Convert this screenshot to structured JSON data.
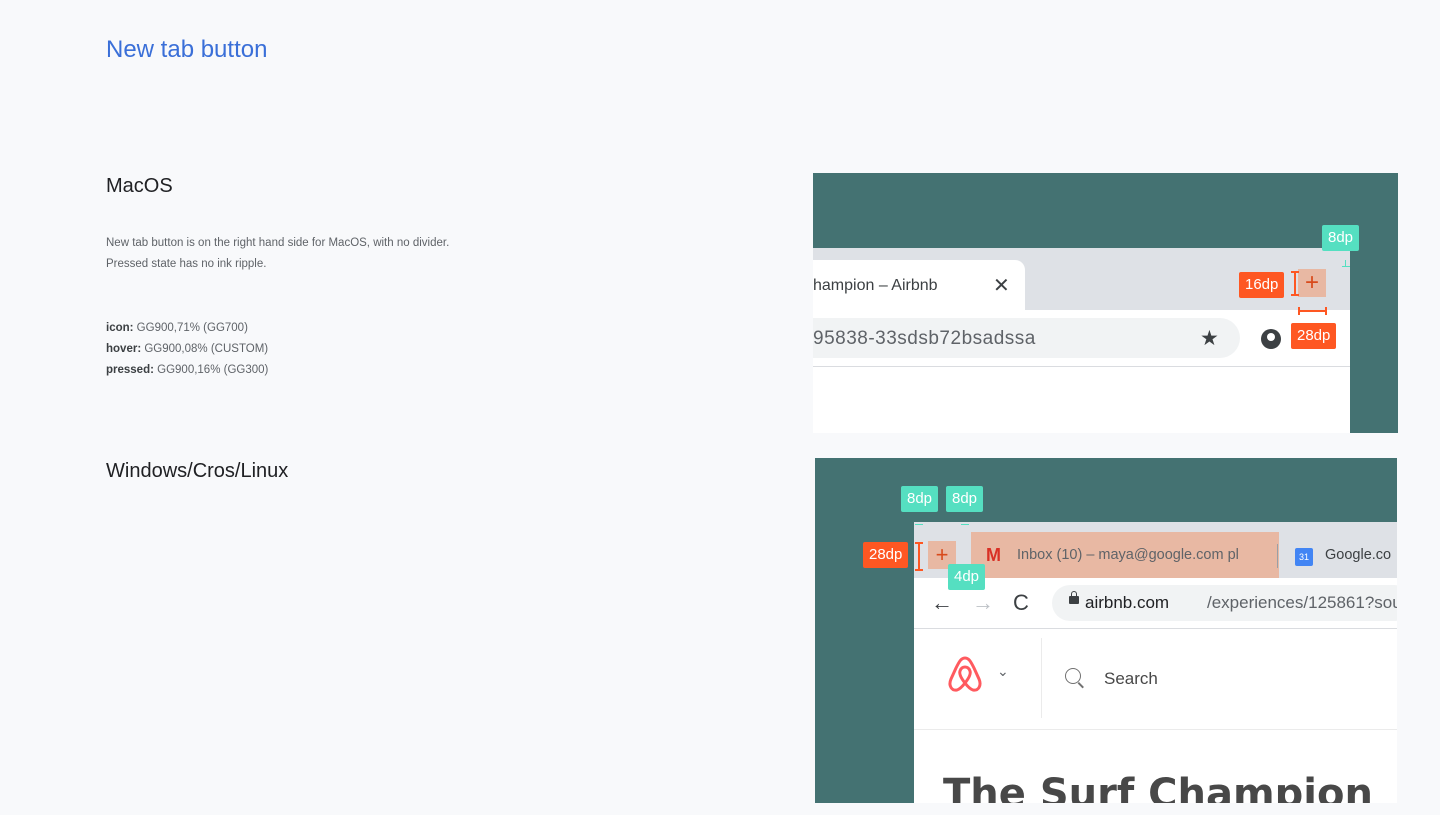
{
  "page": {
    "title": "New tab button"
  },
  "mac": {
    "heading": "MacOS",
    "desc_line1": "New tab button is on the right hand side for MacOS, with no divider.",
    "desc_line2": "Pressed state has no ink ripple.",
    "spec_icon_label": "icon:",
    "spec_icon_value": " GG900,71% (GG700)",
    "spec_hover_label": "hover:",
    "spec_hover_value": " GG900,08% (CUSTOM)",
    "spec_pressed_label": "pressed:",
    "spec_pressed_value": " GG900,16% (GG300)",
    "mock": {
      "tab_title": "hampion – Airbnb",
      "tab_close": "✕",
      "url": "95838-33sdsb72bsadssa",
      "star": "★",
      "newtab_plus": "+",
      "tag_8dp": "8dp",
      "tag_16dp": "16dp",
      "tag_28dp": "28dp"
    }
  },
  "windows": {
    "heading": "Windows/Cros/Linux",
    "mock": {
      "newtab_plus": "+",
      "gmail_icon": "M",
      "inbox_title": "Inbox (10) – maya@google.com pl",
      "cal_icon": "31",
      "google_title": "Google.co",
      "back": "←",
      "forward": "→",
      "reload": "C",
      "url_host": "airbnb.com",
      "url_path": "/experiences/125861?sou",
      "chevron": "⌄",
      "search_label": "Search",
      "headline": "The Surf Champion",
      "tag_8dp_a": "8dp",
      "tag_8dp_b": "8dp",
      "tag_28dp": "28dp",
      "tag_4dp": "4dp"
    }
  },
  "colors": {
    "title_blue": "#3a6fd8",
    "frame_teal": "#447272",
    "redline_orange": "#fe5722",
    "redline_green": "#55dfc1",
    "button_highlight": "#e8b8a3"
  }
}
